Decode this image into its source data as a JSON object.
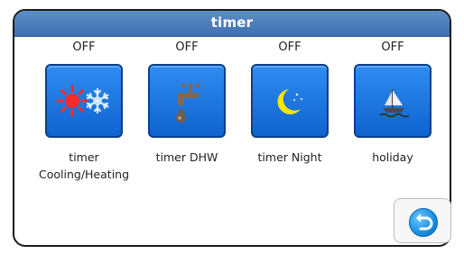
{
  "window": {
    "title": "timer"
  },
  "timers": [
    {
      "status": "OFF",
      "label": "timer Cooling/Heating",
      "icon": "sun-snowflake-icon"
    },
    {
      "status": "OFF",
      "label": "timer DHW",
      "icon": "faucet-icon"
    },
    {
      "status": "OFF",
      "label": "timer Night",
      "icon": "moon-icon"
    },
    {
      "status": "OFF",
      "label": "holiday",
      "icon": "sailboat-icon"
    }
  ],
  "footer": {
    "back_icon": "back-arrow-icon"
  }
}
